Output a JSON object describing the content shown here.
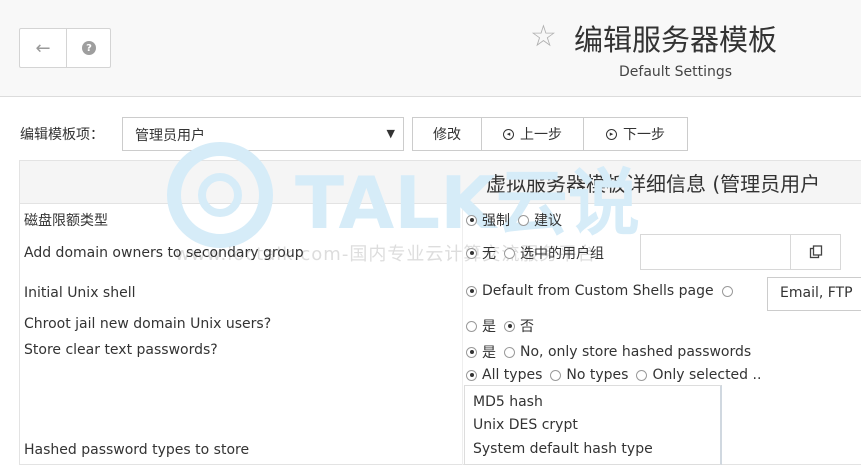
{
  "header": {
    "title": "编辑服务器模板",
    "subtitle": "Default Settings"
  },
  "toolbar": {
    "item_label": "编辑模板项：",
    "selected_item": "管理员用户",
    "edit_button": "修改",
    "prev_button": "上一步",
    "next_button": "下一步"
  },
  "panel": {
    "title": "虚拟服务器模板详细信息 (管理员用户"
  },
  "rows": {
    "quota_type": {
      "label": "磁盘限额类型",
      "opt1": "强制",
      "opt2": "建议"
    },
    "secondary_group": {
      "label": "Add domain owners to secondary group",
      "opt1": "无",
      "opt2": "选中的用户组"
    },
    "unix_shell": {
      "label": "Initial Unix shell",
      "opt1": "Default from Custom Shells page",
      "select_value": "Email, FTP"
    },
    "chroot": {
      "label": "Chroot jail new domain Unix users?",
      "opt1": "是",
      "opt2": "否"
    },
    "clear_passwords": {
      "label": "Store clear text passwords?",
      "opt1": "是",
      "opt2": "No, only store hashed passwords"
    },
    "hash_types": {
      "label": "Hashed password types to store",
      "opt1": "All types",
      "opt2": "No types",
      "opt3": "Only selected ..",
      "list": [
        "MD5 hash",
        "Unix DES crypt",
        "System default hash type"
      ]
    }
  },
  "watermark": {
    "text": "www.ioctalk.com-国内专业云计算交流服务平台-",
    "brand": "TALK云说"
  },
  "colors": {
    "watermark": "#cfe8f7"
  }
}
